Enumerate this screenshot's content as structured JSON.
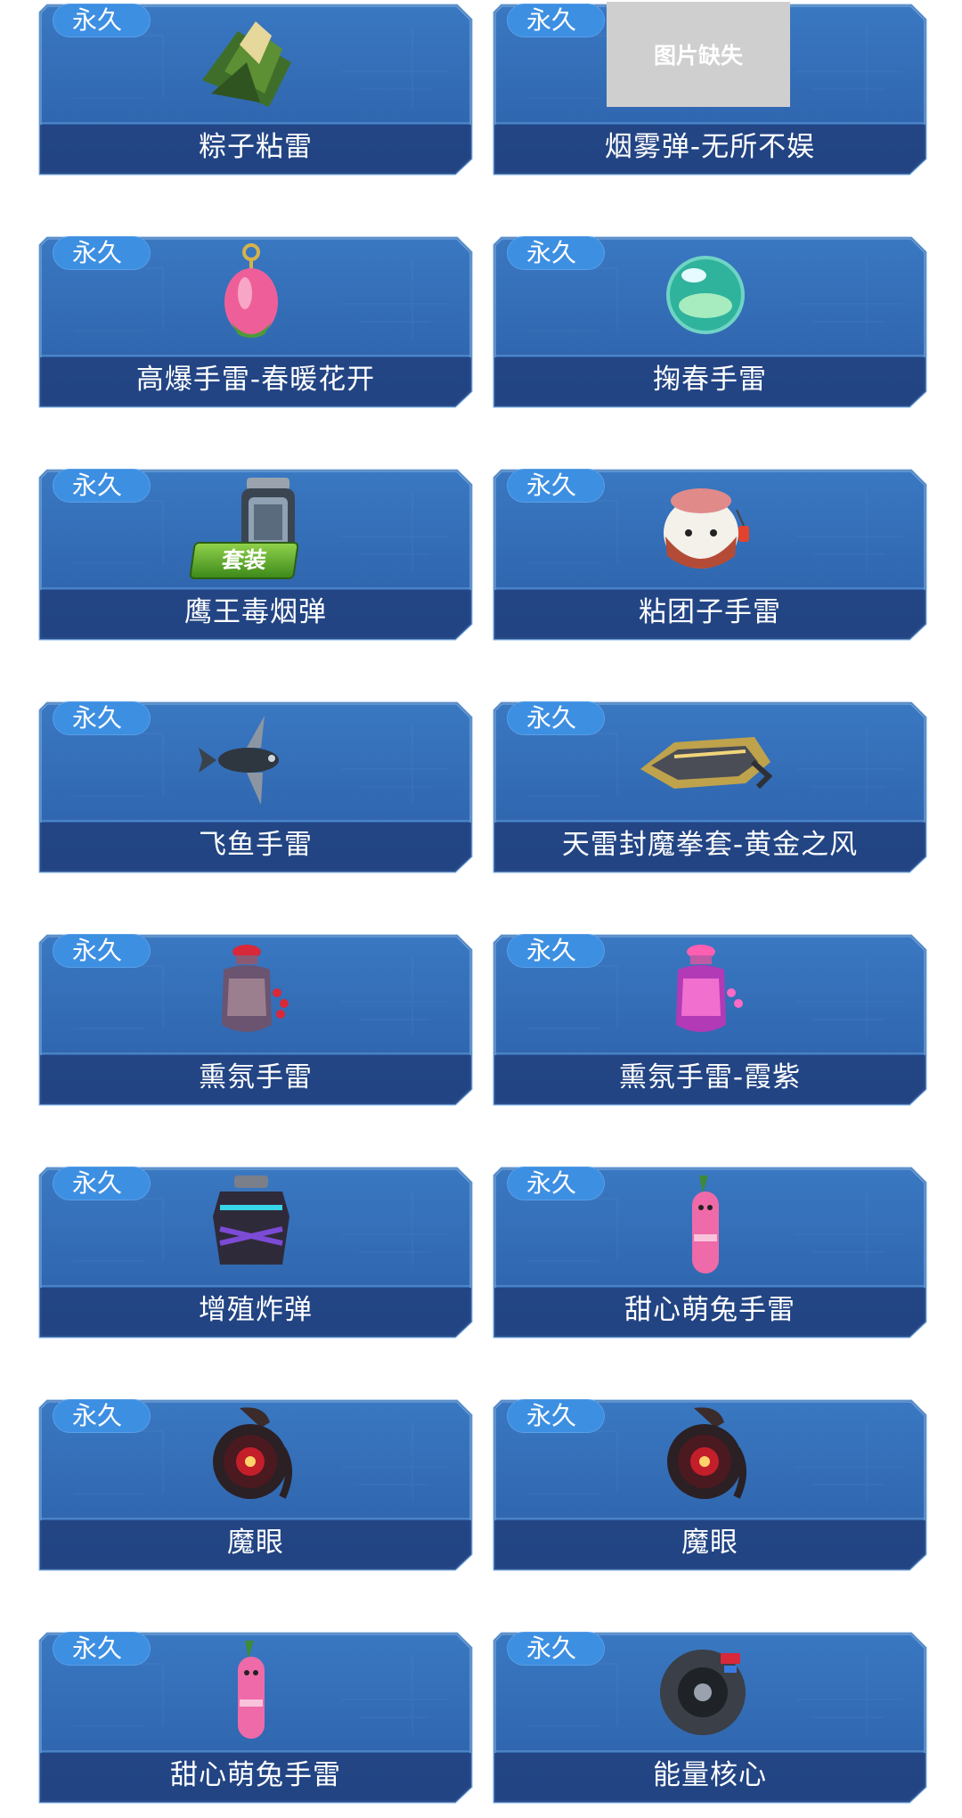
{
  "items": [
    {
      "name": "粽子粘雷",
      "badge": "永久",
      "icon": "zongzi-grenade-icon"
    },
    {
      "name": "烟雾弹-无所不娱",
      "badge": "永久",
      "icon": "image-missing-placeholder",
      "placeholder_text": "图片缺失"
    },
    {
      "name": "高爆手雷-春暖花开",
      "badge": "永久",
      "icon": "pink-flower-bud-grenade-icon"
    },
    {
      "name": "掬春手雷",
      "badge": "永久",
      "icon": "green-glass-orb-grenade-icon"
    },
    {
      "name": "鹰王毒烟弹",
      "badge": "永久",
      "icon": "eagle-smoke-grenade-icon",
      "kit_label": "套装"
    },
    {
      "name": "粘团子手雷",
      "badge": "永久",
      "icon": "dumpling-grenade-icon"
    },
    {
      "name": "飞鱼手雷",
      "badge": "永久",
      "icon": "flying-fish-grenade-icon"
    },
    {
      "name": "天雷封魔拳套-黄金之风",
      "badge": "永久",
      "icon": "golden-gauntlet-icon"
    },
    {
      "name": "熏氛手雷",
      "badge": "永久",
      "icon": "incense-vase-grenade-icon"
    },
    {
      "name": "熏氛手雷-霞紫",
      "badge": "永久",
      "icon": "purple-incense-vase-grenade-icon"
    },
    {
      "name": "增殖炸弹",
      "badge": "永久",
      "icon": "proliferation-bomb-icon"
    },
    {
      "name": "甜心萌兔手雷",
      "badge": "永久",
      "icon": "pink-bunny-grenade-icon"
    },
    {
      "name": "魔眼",
      "badge": "永久",
      "icon": "demon-eye-grenade-icon"
    },
    {
      "name": "魔眼",
      "badge": "永久",
      "icon": "demon-eye-grenade-icon"
    },
    {
      "name": "甜心萌兔手雷",
      "badge": "永久",
      "icon": "pink-bunny-grenade-icon"
    },
    {
      "name": "能量核心",
      "badge": "永久",
      "icon": "energy-core-icon"
    }
  ],
  "colors": {
    "card_top": "#3a78c2",
    "card_bottom": "#2b5fa7",
    "name_bar": "#213f7c",
    "border": "#7fb2e8",
    "badge": "#3d8fe2",
    "page_bg": "#ffffff"
  }
}
